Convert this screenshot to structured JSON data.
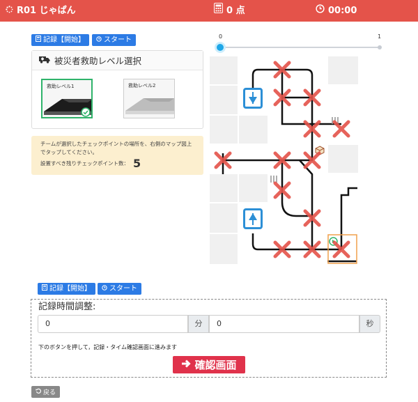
{
  "header": {
    "team": "R01 じゃぱん",
    "score": "0 点",
    "timer": "00:00"
  },
  "top_controls": {
    "record_label": "記録【開始】",
    "start_label": "スタート"
  },
  "rescue_panel": {
    "title": "被災者救助レベル選択",
    "levels": [
      {
        "label": "救助レベル1",
        "selected": true
      },
      {
        "label": "救助レベル2",
        "selected": false
      }
    ]
  },
  "notice": {
    "line1": "チームが選択したチェックポイントの場所を、右側のマップ図上",
    "line2": "でタップしてください。",
    "remaining_label": "設置すべき残りチェックポイント数：",
    "remaining_count": "5"
  },
  "slider": {
    "min_label": "0",
    "max_label": "1",
    "value": 0
  },
  "bottom_controls": {
    "record_label": "記録【開始】",
    "start_label": "スタート"
  },
  "time_adjust": {
    "title": "記録時間調整:",
    "minutes_value": "0",
    "minutes_unit": "分",
    "seconds_value": "0",
    "seconds_unit": "秒",
    "hint": "下のボタンを押して，記録・タイム確認画面に進みます",
    "confirm_label": "確認画面"
  },
  "back_label": "戻る",
  "colors": {
    "header": "#e4534a",
    "primary": "#2c7be5",
    "danger": "#e0324b",
    "checkpoint_x": "#e4534a",
    "notice_bg": "#fcefcf",
    "selected_border": "#2fb36a",
    "goal_border": "#f0a04b"
  }
}
